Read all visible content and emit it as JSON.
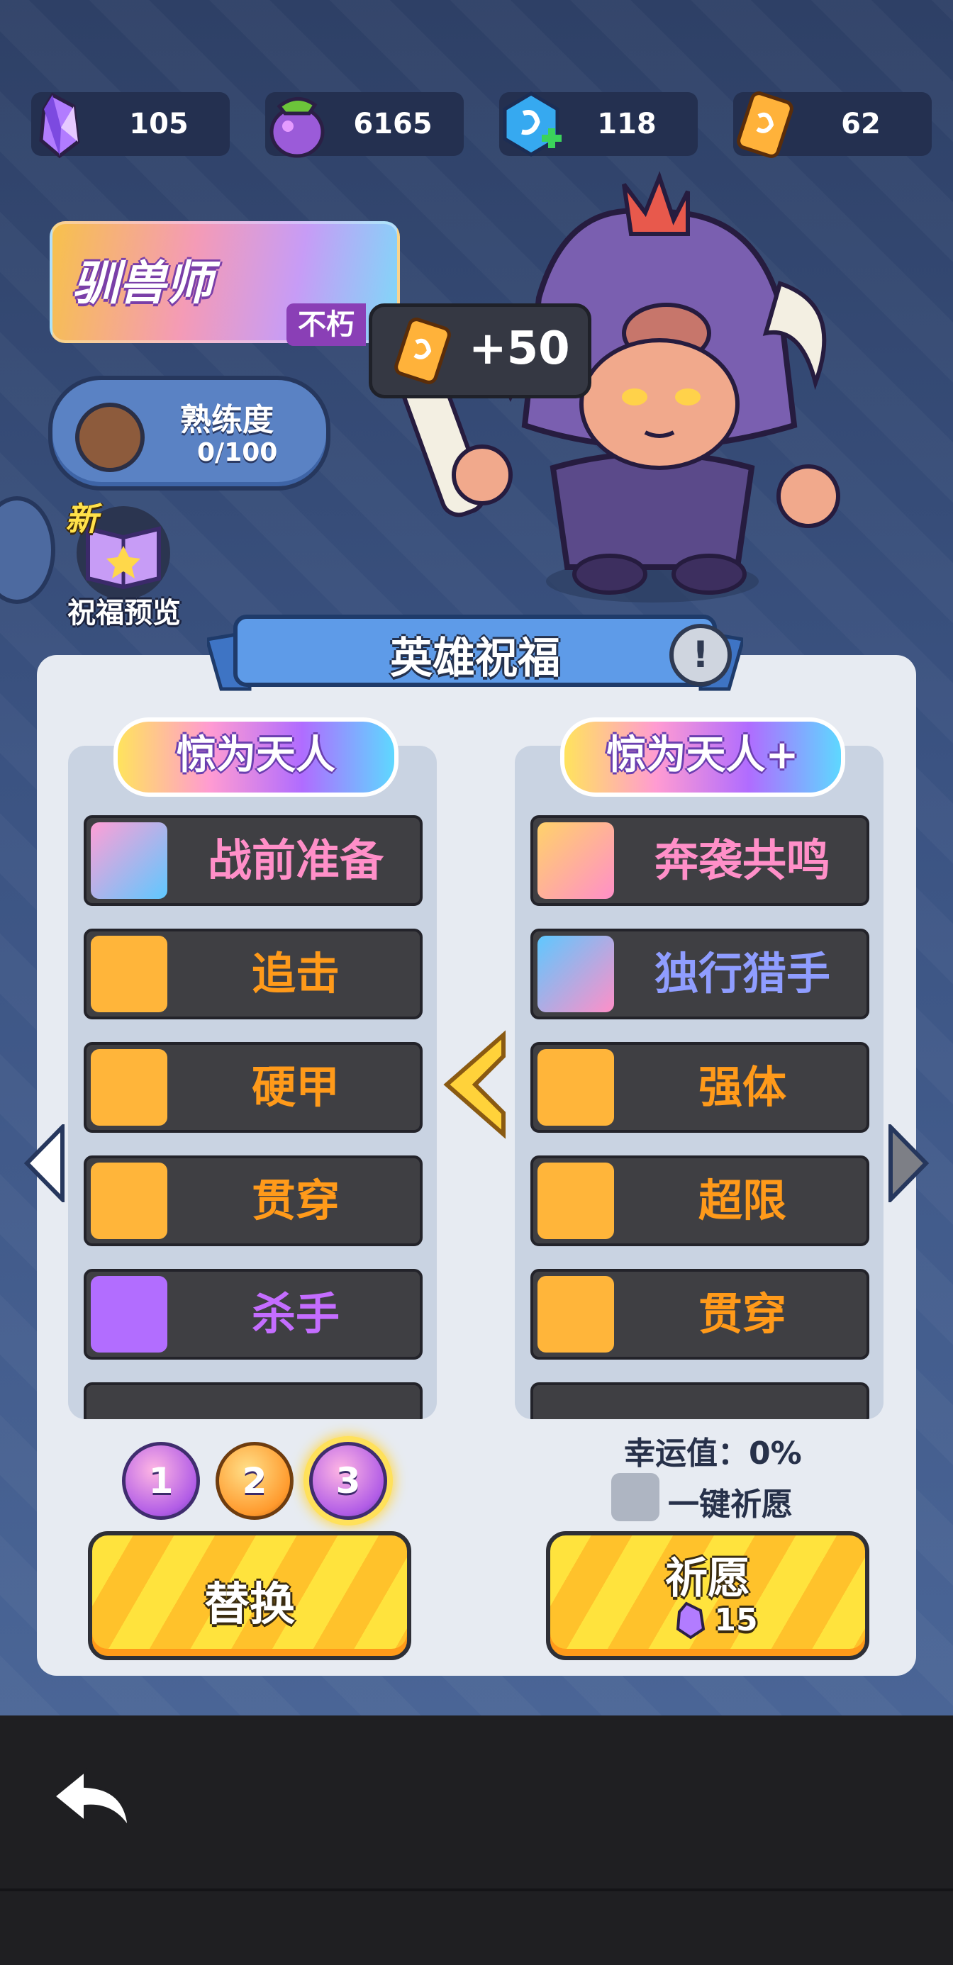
{
  "resources": [
    {
      "icon": "crystal-icon",
      "value": "105"
    },
    {
      "icon": "potion-icon",
      "value": "6165"
    },
    {
      "icon": "rune-plus-icon",
      "value": "118"
    },
    {
      "icon": "ticket-icon",
      "value": "62"
    }
  ],
  "hero": {
    "class_name": "驯兽师",
    "badge": "不朽",
    "proficiency_label": "熟练度",
    "proficiency_value": "0/100",
    "reward": "+50"
  },
  "blessing_preview": {
    "new_tag": "新",
    "label": "祝福预览"
  },
  "panel": {
    "title": "英雄祝福",
    "left_column": {
      "title": "惊为天人",
      "items": [
        {
          "name": "战前准备",
          "color": "gradient",
          "icon": "wolf-icon"
        },
        {
          "name": "追击",
          "color": "orange",
          "icon": "arrow-burst-icon"
        },
        {
          "name": "硬甲",
          "color": "orange",
          "icon": "bomb-icon"
        },
        {
          "name": "贯穿",
          "color": "orange",
          "icon": "pierce-arrow-icon"
        },
        {
          "name": "杀手",
          "color": "purple",
          "icon": "dagger-icon"
        }
      ]
    },
    "right_column": {
      "title": "惊为天人+",
      "items": [
        {
          "name": "奔袭共鸣",
          "color": "gradient",
          "icon": "resonance-icon"
        },
        {
          "name": "独行猎手",
          "color": "gradient2",
          "icon": "hunter-icon"
        },
        {
          "name": "强体",
          "color": "orange",
          "icon": "heart-icon"
        },
        {
          "name": "超限",
          "color": "orange",
          "icon": "limit-icon"
        },
        {
          "name": "贯穿",
          "color": "orange",
          "icon": "pierce-arrow-icon"
        }
      ]
    },
    "pages": [
      "1",
      "2",
      "3"
    ],
    "luck_text": "幸运值：0%",
    "auto_pray_label": "一键祈愿",
    "replace_label": "替换",
    "pray_label": "祈愿",
    "pray_cost": "15"
  }
}
